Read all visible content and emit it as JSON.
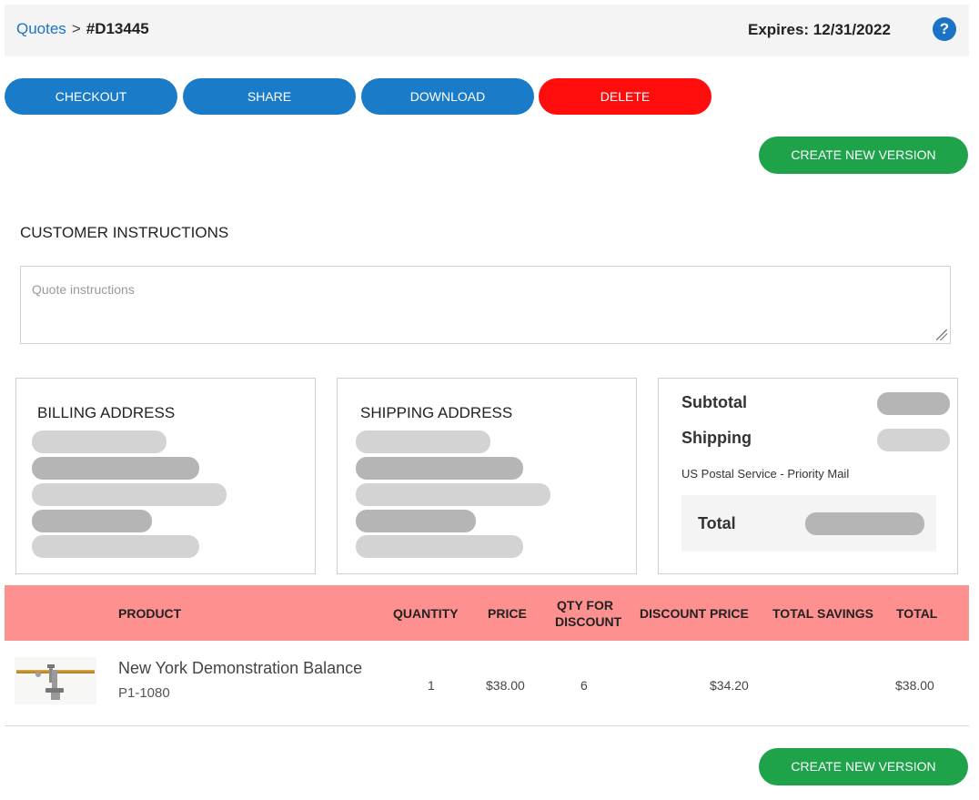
{
  "header": {
    "breadcrumb_link": "Quotes",
    "breadcrumb_sep": ">",
    "quote_id": "#D13445",
    "expires": "Expires: 12/31/2022",
    "help_icon": "?"
  },
  "actions": {
    "checkout": "CHECKOUT",
    "share": "SHARE",
    "download": "DOWNLOAD",
    "delete": "DELETE",
    "create_new_version": "CREATE NEW VERSION"
  },
  "colors": {
    "primary_blue": "#1a7cc9",
    "danger_red": "#ff0d0d",
    "success_green": "#1ea34b",
    "table_header": "#ff9090"
  },
  "customer_instructions": {
    "title": "CUSTOMER INSTRUCTIONS",
    "placeholder": "Quote instructions"
  },
  "billing": {
    "title": "BILLING ADDRESS"
  },
  "shipping": {
    "title": "SHIPPING ADDRESS"
  },
  "summary": {
    "subtotal_label": "Subtotal",
    "shipping_label": "Shipping",
    "shipping_method": "US Postal Service - Priority Mail",
    "total_label": "Total"
  },
  "table": {
    "headers": {
      "product": "PRODUCT",
      "quantity": "QUANTITY",
      "price": "PRICE",
      "qty_for_discount_1": "QTY FOR",
      "qty_for_discount_2": "DISCOUNT",
      "discount_price": "DISCOUNT PRICE",
      "total_savings": "TOTAL SAVINGS",
      "total": "TOTAL"
    },
    "rows": [
      {
        "name": "New York Demonstration Balance",
        "sku": "P1-1080",
        "quantity": "1",
        "price": "$38.00",
        "qty_for_discount": "6",
        "discount_price": "$34.20",
        "total_savings": "",
        "total": "$38.00",
        "image_icon": "balance-scale-product-image"
      }
    ]
  }
}
